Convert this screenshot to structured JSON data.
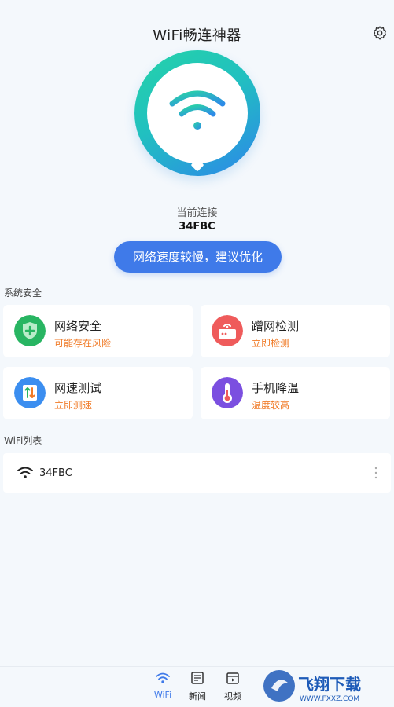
{
  "header": {
    "title": "WiFi畅连神器"
  },
  "hero": {
    "current_label": "当前连接",
    "ssid": "34FBC",
    "button": "网络速度较慢，建议优化"
  },
  "security": {
    "label": "系统安全",
    "cards": [
      {
        "title": "网络安全",
        "sub": "可能存在风险",
        "icon": "shield-icon"
      },
      {
        "title": "蹭网检测",
        "sub": "立即检测",
        "icon": "router-icon"
      },
      {
        "title": "网速测试",
        "sub": "立即测速",
        "icon": "speed-icon"
      },
      {
        "title": "手机降温",
        "sub": "温度较高",
        "icon": "thermometer-icon"
      }
    ]
  },
  "wifi_list": {
    "label": "WiFi列表",
    "items": [
      {
        "name": "34FBC"
      }
    ]
  },
  "nav": {
    "items": [
      {
        "label": "WiFi"
      },
      {
        "label": "新闻"
      },
      {
        "label": "视频"
      }
    ]
  },
  "watermark": {
    "text": "飞翔下载",
    "url": "WWW.FXXZ.COM"
  },
  "colors": {
    "accent": "#3f7ae9",
    "warning": "#f07a26",
    "teal": "#25d3a8"
  }
}
